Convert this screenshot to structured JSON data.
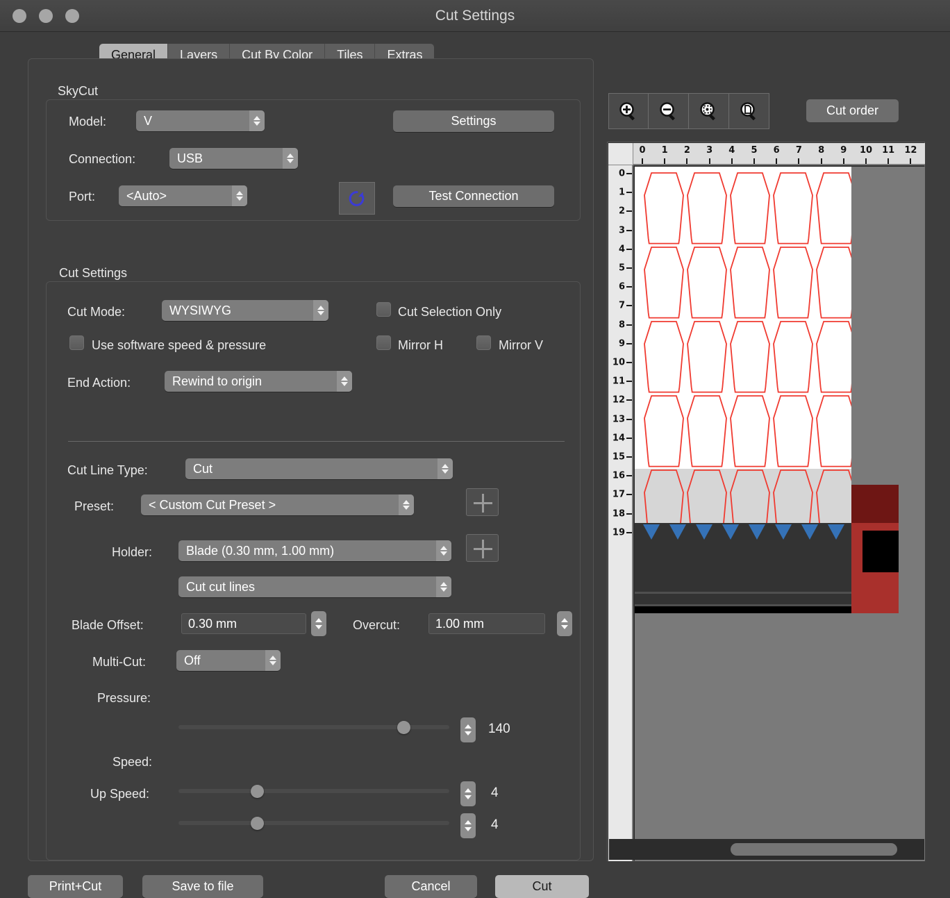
{
  "window": {
    "title": "Cut Settings",
    "traffic_lights": [
      "close-button",
      "minimize-button",
      "zoom-button"
    ]
  },
  "tabs": [
    {
      "label": "General",
      "active": true
    },
    {
      "label": "Layers",
      "active": false
    },
    {
      "label": "Cut By Color",
      "active": false
    },
    {
      "label": "Tiles",
      "active": false
    },
    {
      "label": "Extras",
      "active": false
    }
  ],
  "skycut": {
    "group_label": "SkyCut",
    "model_label": "Model:",
    "model_value": "V",
    "settings_button": "Settings",
    "connection_label": "Connection:",
    "connection_value": "USB",
    "port_label": "Port:",
    "port_value": "<Auto>",
    "refresh_icon": "refresh-icon",
    "test_connection_button": "Test Connection"
  },
  "cut_settings": {
    "group_label": "Cut Settings",
    "cut_mode_label": "Cut Mode:",
    "cut_mode_value": "WYSIWYG",
    "cut_selection_only_label": "Cut Selection Only",
    "cut_selection_only_checked": false,
    "use_software_label": "Use software speed & pressure",
    "use_software_checked": false,
    "mirror_h_label": "Mirror H",
    "mirror_h_checked": false,
    "mirror_v_label": "Mirror V",
    "mirror_v_checked": false,
    "end_action_label": "End Action:",
    "end_action_value": "Rewind to origin",
    "cut_line_type_label": "Cut Line Type:",
    "cut_line_type_value": "Cut",
    "preset_label": "Preset:",
    "preset_value": "< Custom Cut Preset >",
    "preset_add_icon": "plus-icon",
    "holder_label": "Holder:",
    "holder_value": "Blade (0.30 mm, 1.00 mm)",
    "holder_add_icon": "plus-icon",
    "holder_action_value": "Cut cut lines",
    "blade_offset_label": "Blade Offset:",
    "blade_offset_value": "0.30 mm",
    "overcut_label": "Overcut:",
    "overcut_value": "1.00 mm",
    "multicut_label": "Multi-Cut:",
    "multicut_value": "Off",
    "pressure_label": "Pressure:",
    "pressure_value": "140",
    "pressure_percent": 85,
    "speed_label": "Speed:",
    "speed_value": "4",
    "speed_percent": 28,
    "up_speed_label": "Up Speed:",
    "up_speed_value": "4",
    "up_speed_percent": 28
  },
  "preview": {
    "zoom_in_icon": "zoom-in-icon",
    "zoom_out_icon": "zoom-out-icon",
    "zoom_fit_icon": "zoom-fit-selection-icon",
    "zoom_page_icon": "zoom-fit-page-icon",
    "cut_order_button": "Cut order",
    "h_ruler_ticks": [
      "0",
      "1",
      "2",
      "3",
      "4",
      "5",
      "6",
      "7",
      "8",
      "9",
      "10",
      "11",
      "12"
    ],
    "v_ruler_ticks": [
      "0",
      "1",
      "2",
      "3",
      "4",
      "5",
      "6",
      "7",
      "8",
      "9",
      "10",
      "11",
      "12",
      "13",
      "14",
      "15",
      "16",
      "17",
      "18",
      "19"
    ],
    "shape_color": "#f03a30",
    "shape_rows": 5,
    "shape_cols": 5,
    "registration_marker_count": 8,
    "registration_marker_color": "#3572b7"
  },
  "footer": {
    "print_cut_button": "Print+Cut",
    "save_to_file_button": "Save to file",
    "cancel_button": "Cancel",
    "cut_button": "Cut"
  }
}
